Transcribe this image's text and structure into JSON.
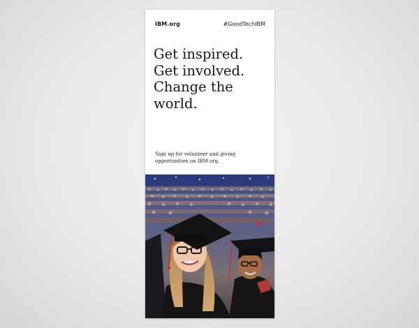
{
  "banner": {
    "brand": "IBM.org",
    "hashtag": "#GoodTechIBM",
    "headline_lines": [
      "Get inspired.",
      "Get involved.",
      "Change the",
      "world."
    ],
    "subtext": "Sign up for volunteer and giving opportunities on IBM.org.",
    "photo": "graduates-in-caps-and-gowns-photo"
  },
  "colors": {
    "text": "#161616",
    "background": "#ffffff",
    "gown": "#141414"
  }
}
